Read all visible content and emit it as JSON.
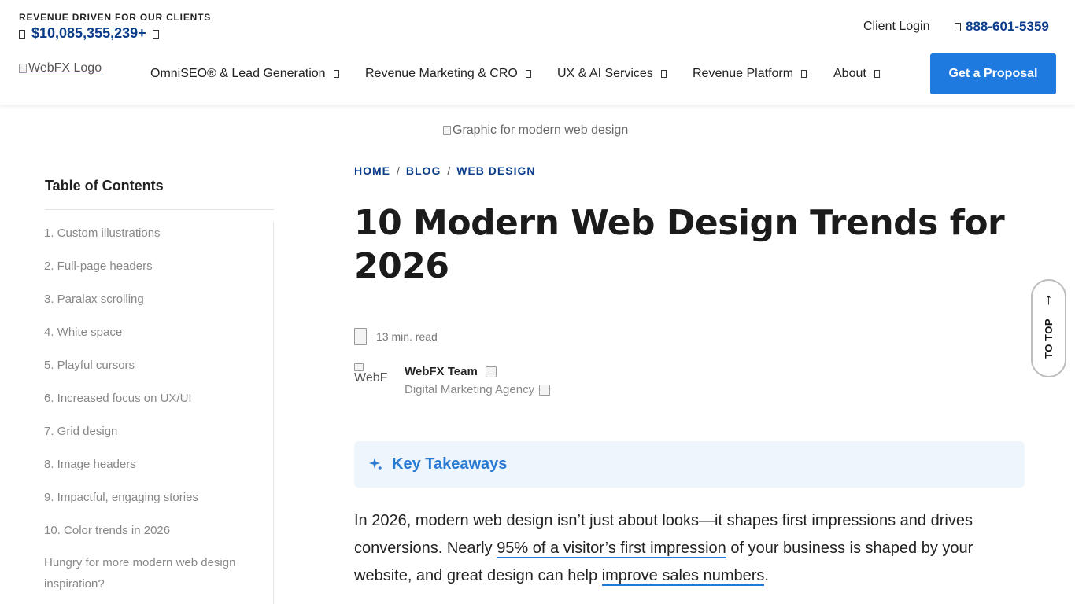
{
  "header": {
    "revenue_label": "REVENUE DRIVEN FOR OUR CLIENTS",
    "revenue_amount": "$10,085,355,239+",
    "client_login": "Client Login",
    "phone": "888-601-5359",
    "logo_alt": "WebFX Logo",
    "nav": [
      {
        "label": "OmniSEO® & Lead Generation"
      },
      {
        "label": "Revenue Marketing & CRO"
      },
      {
        "label": "UX & AI Services"
      },
      {
        "label": "Revenue Platform"
      },
      {
        "label": "About"
      }
    ],
    "cta": "Get a Proposal"
  },
  "hero": {
    "image_alt": "Graphic for modern web design"
  },
  "toc": {
    "title": "Table of Contents",
    "items": [
      "1. Custom illustrations",
      "2. Full-page headers",
      "3. Paralax scrolling",
      "4. White space",
      "5. Playful cursors",
      "6. Increased focus on UX/UI",
      "7. Grid design",
      "8. Image headers",
      "9. Impactful, engaging stories",
      "10. Color trends in 2026",
      "Hungry for more modern web design inspiration?"
    ]
  },
  "article": {
    "breadcrumb": [
      "HOME",
      "BLOG",
      "WEB DESIGN"
    ],
    "breadcrumb_sep": "/",
    "title": "10 Modern Web Design Trends for 2026",
    "read_time": "13 min. read",
    "author_img_alt": "WebF",
    "author_name": "WebFX Team",
    "author_org": "Digital Marketing Agency",
    "key_takeaways": "Key Takeaways",
    "intro": {
      "p1": "In 2026, modern web design isn’t just about looks—it shapes first impressions and drives conversions. Nearly ",
      "link1": "95% of a visitor’s first impression",
      "p2": " of your business is shaped by your website, and great design can help ",
      "link2": "improve sales numbers",
      "p3": "."
    }
  },
  "to_top": {
    "arrow": "↑",
    "label": "TO TOP"
  },
  "colors": {
    "brand_navy": "#0b3d8a",
    "cta_blue": "#1f7ae0",
    "takeaway_bg": "#eef5fc",
    "takeaway_text": "#2a7bd4"
  },
  "icons": [
    "phone-icon",
    "chevron-down-icon",
    "sparkle-icon",
    "arrow-up-icon"
  ]
}
